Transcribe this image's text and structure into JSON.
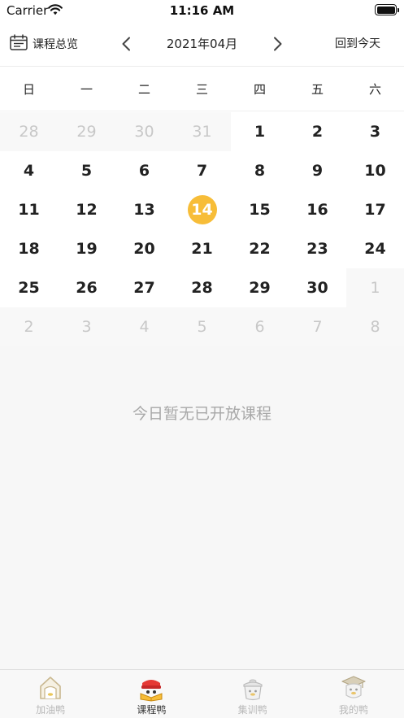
{
  "status_bar": {
    "carrier": "Carrier",
    "time": "11:16 AM"
  },
  "nav": {
    "overview_label": "课程总览",
    "month_label": "2021年04月",
    "today_label": "回到今天"
  },
  "calendar": {
    "weekdays": [
      "日",
      "一",
      "二",
      "三",
      "四",
      "五",
      "六"
    ],
    "rows": [
      [
        {
          "day": "28",
          "outside": true
        },
        {
          "day": "29",
          "outside": true
        },
        {
          "day": "30",
          "outside": true
        },
        {
          "day": "31",
          "outside": true
        },
        {
          "day": "1"
        },
        {
          "day": "2"
        },
        {
          "day": "3"
        }
      ],
      [
        {
          "day": "4"
        },
        {
          "day": "5"
        },
        {
          "day": "6"
        },
        {
          "day": "7"
        },
        {
          "day": "8"
        },
        {
          "day": "9"
        },
        {
          "day": "10"
        }
      ],
      [
        {
          "day": "11"
        },
        {
          "day": "12"
        },
        {
          "day": "13"
        },
        {
          "day": "14",
          "selected": true
        },
        {
          "day": "15"
        },
        {
          "day": "16"
        },
        {
          "day": "17"
        }
      ],
      [
        {
          "day": "18"
        },
        {
          "day": "19"
        },
        {
          "day": "20"
        },
        {
          "day": "21"
        },
        {
          "day": "22"
        },
        {
          "day": "23"
        },
        {
          "day": "24"
        }
      ],
      [
        {
          "day": "25"
        },
        {
          "day": "26"
        },
        {
          "day": "27"
        },
        {
          "day": "28"
        },
        {
          "day": "29"
        },
        {
          "day": "30"
        },
        {
          "day": "1",
          "outside": true
        }
      ],
      [
        {
          "day": "2",
          "outside": true
        },
        {
          "day": "3",
          "outside": true
        },
        {
          "day": "4",
          "outside": true
        },
        {
          "day": "5",
          "outside": true
        },
        {
          "day": "6",
          "outside": true
        },
        {
          "day": "7",
          "outside": true
        },
        {
          "day": "8",
          "outside": true
        }
      ]
    ],
    "selected_color": "#f7bd38"
  },
  "content": {
    "empty_text": "今日暂无已开放课程"
  },
  "tab_bar": {
    "tabs": [
      {
        "label": "加油鸭",
        "icon": "duck-house-icon",
        "active": false
      },
      {
        "label": "课程鸭",
        "icon": "duck-book-icon",
        "active": true
      },
      {
        "label": "集训鸭",
        "icon": "duck-pot-icon",
        "active": false
      },
      {
        "label": "我的鸭",
        "icon": "duck-graduate-icon",
        "active": false
      }
    ]
  }
}
